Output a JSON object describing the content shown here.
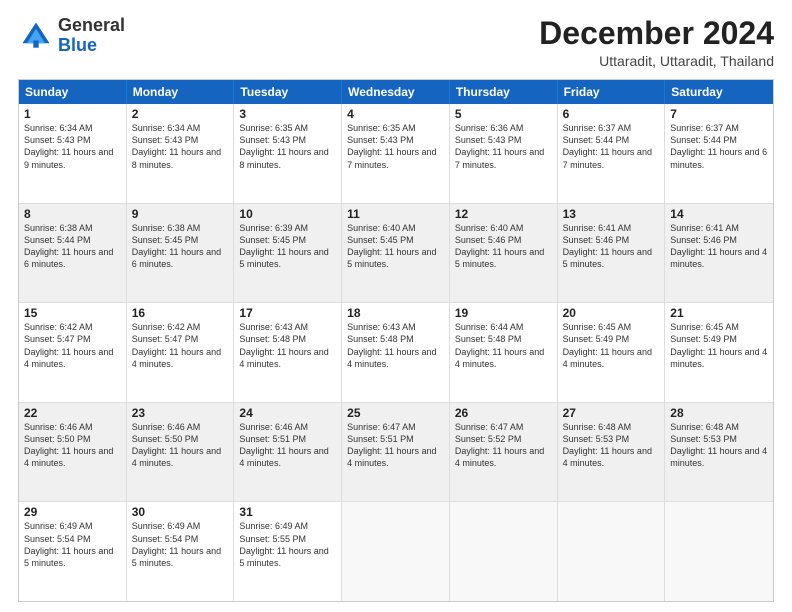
{
  "header": {
    "logo": {
      "line1": "General",
      "line2": "Blue"
    },
    "title": "December 2024",
    "subtitle": "Uttaradit, Uttaradit, Thailand"
  },
  "weekdays": [
    "Sunday",
    "Monday",
    "Tuesday",
    "Wednesday",
    "Thursday",
    "Friday",
    "Saturday"
  ],
  "weeks": [
    [
      {
        "day": "1",
        "sunrise": "6:34 AM",
        "sunset": "5:43 PM",
        "daylight": "11 hours and 9 minutes.",
        "shaded": false
      },
      {
        "day": "2",
        "sunrise": "6:34 AM",
        "sunset": "5:43 PM",
        "daylight": "11 hours and 8 minutes.",
        "shaded": false
      },
      {
        "day": "3",
        "sunrise": "6:35 AM",
        "sunset": "5:43 PM",
        "daylight": "11 hours and 8 minutes.",
        "shaded": false
      },
      {
        "day": "4",
        "sunrise": "6:35 AM",
        "sunset": "5:43 PM",
        "daylight": "11 hours and 7 minutes.",
        "shaded": false
      },
      {
        "day": "5",
        "sunrise": "6:36 AM",
        "sunset": "5:43 PM",
        "daylight": "11 hours and 7 minutes.",
        "shaded": false
      },
      {
        "day": "6",
        "sunrise": "6:37 AM",
        "sunset": "5:44 PM",
        "daylight": "11 hours and 7 minutes.",
        "shaded": false
      },
      {
        "day": "7",
        "sunrise": "6:37 AM",
        "sunset": "5:44 PM",
        "daylight": "11 hours and 6 minutes.",
        "shaded": false
      }
    ],
    [
      {
        "day": "8",
        "sunrise": "6:38 AM",
        "sunset": "5:44 PM",
        "daylight": "11 hours and 6 minutes.",
        "shaded": true
      },
      {
        "day": "9",
        "sunrise": "6:38 AM",
        "sunset": "5:45 PM",
        "daylight": "11 hours and 6 minutes.",
        "shaded": true
      },
      {
        "day": "10",
        "sunrise": "6:39 AM",
        "sunset": "5:45 PM",
        "daylight": "11 hours and 5 minutes.",
        "shaded": true
      },
      {
        "day": "11",
        "sunrise": "6:40 AM",
        "sunset": "5:45 PM",
        "daylight": "11 hours and 5 minutes.",
        "shaded": true
      },
      {
        "day": "12",
        "sunrise": "6:40 AM",
        "sunset": "5:46 PM",
        "daylight": "11 hours and 5 minutes.",
        "shaded": true
      },
      {
        "day": "13",
        "sunrise": "6:41 AM",
        "sunset": "5:46 PM",
        "daylight": "11 hours and 5 minutes.",
        "shaded": true
      },
      {
        "day": "14",
        "sunrise": "6:41 AM",
        "sunset": "5:46 PM",
        "daylight": "11 hours and 4 minutes.",
        "shaded": true
      }
    ],
    [
      {
        "day": "15",
        "sunrise": "6:42 AM",
        "sunset": "5:47 PM",
        "daylight": "11 hours and 4 minutes.",
        "shaded": false
      },
      {
        "day": "16",
        "sunrise": "6:42 AM",
        "sunset": "5:47 PM",
        "daylight": "11 hours and 4 minutes.",
        "shaded": false
      },
      {
        "day": "17",
        "sunrise": "6:43 AM",
        "sunset": "5:48 PM",
        "daylight": "11 hours and 4 minutes.",
        "shaded": false
      },
      {
        "day": "18",
        "sunrise": "6:43 AM",
        "sunset": "5:48 PM",
        "daylight": "11 hours and 4 minutes.",
        "shaded": false
      },
      {
        "day": "19",
        "sunrise": "6:44 AM",
        "sunset": "5:48 PM",
        "daylight": "11 hours and 4 minutes.",
        "shaded": false
      },
      {
        "day": "20",
        "sunrise": "6:45 AM",
        "sunset": "5:49 PM",
        "daylight": "11 hours and 4 minutes.",
        "shaded": false
      },
      {
        "day": "21",
        "sunrise": "6:45 AM",
        "sunset": "5:49 PM",
        "daylight": "11 hours and 4 minutes.",
        "shaded": false
      }
    ],
    [
      {
        "day": "22",
        "sunrise": "6:46 AM",
        "sunset": "5:50 PM",
        "daylight": "11 hours and 4 minutes.",
        "shaded": true
      },
      {
        "day": "23",
        "sunrise": "6:46 AM",
        "sunset": "5:50 PM",
        "daylight": "11 hours and 4 minutes.",
        "shaded": true
      },
      {
        "day": "24",
        "sunrise": "6:46 AM",
        "sunset": "5:51 PM",
        "daylight": "11 hours and 4 minutes.",
        "shaded": true
      },
      {
        "day": "25",
        "sunrise": "6:47 AM",
        "sunset": "5:51 PM",
        "daylight": "11 hours and 4 minutes.",
        "shaded": true
      },
      {
        "day": "26",
        "sunrise": "6:47 AM",
        "sunset": "5:52 PM",
        "daylight": "11 hours and 4 minutes.",
        "shaded": true
      },
      {
        "day": "27",
        "sunrise": "6:48 AM",
        "sunset": "5:53 PM",
        "daylight": "11 hours and 4 minutes.",
        "shaded": true
      },
      {
        "day": "28",
        "sunrise": "6:48 AM",
        "sunset": "5:53 PM",
        "daylight": "11 hours and 4 minutes.",
        "shaded": true
      }
    ],
    [
      {
        "day": "29",
        "sunrise": "6:49 AM",
        "sunset": "5:54 PM",
        "daylight": "11 hours and 5 minutes.",
        "shaded": false
      },
      {
        "day": "30",
        "sunrise": "6:49 AM",
        "sunset": "5:54 PM",
        "daylight": "11 hours and 5 minutes.",
        "shaded": false
      },
      {
        "day": "31",
        "sunrise": "6:49 AM",
        "sunset": "5:55 PM",
        "daylight": "11 hours and 5 minutes.",
        "shaded": false
      },
      {
        "day": "",
        "shaded": false
      },
      {
        "day": "",
        "shaded": false
      },
      {
        "day": "",
        "shaded": false
      },
      {
        "day": "",
        "shaded": false
      }
    ]
  ]
}
